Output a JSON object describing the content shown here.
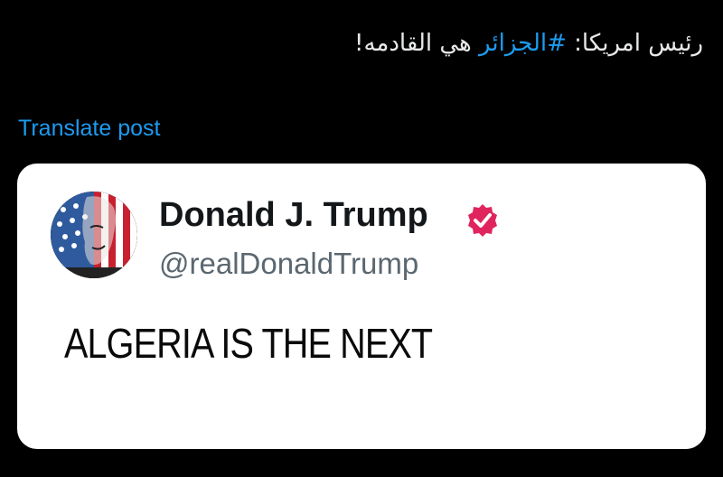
{
  "post": {
    "text_before": "رئيس امريكا: ",
    "hashtag": "#الجزائر",
    "text_after": " هي القادمه!",
    "translate_label": "Translate post"
  },
  "quoted_card": {
    "display_name": "Donald J. Trump",
    "handle": "@realDonaldTrump",
    "body_text": "ALGERIA IS THE NEXT",
    "verified": true,
    "avatar_icon": "american-flag-face-avatar",
    "badge_color": "#e0245e"
  },
  "colors": {
    "background": "#000000",
    "text": "#e7e9ea",
    "link": "#1d9bf0",
    "card_background": "#ffffff"
  }
}
